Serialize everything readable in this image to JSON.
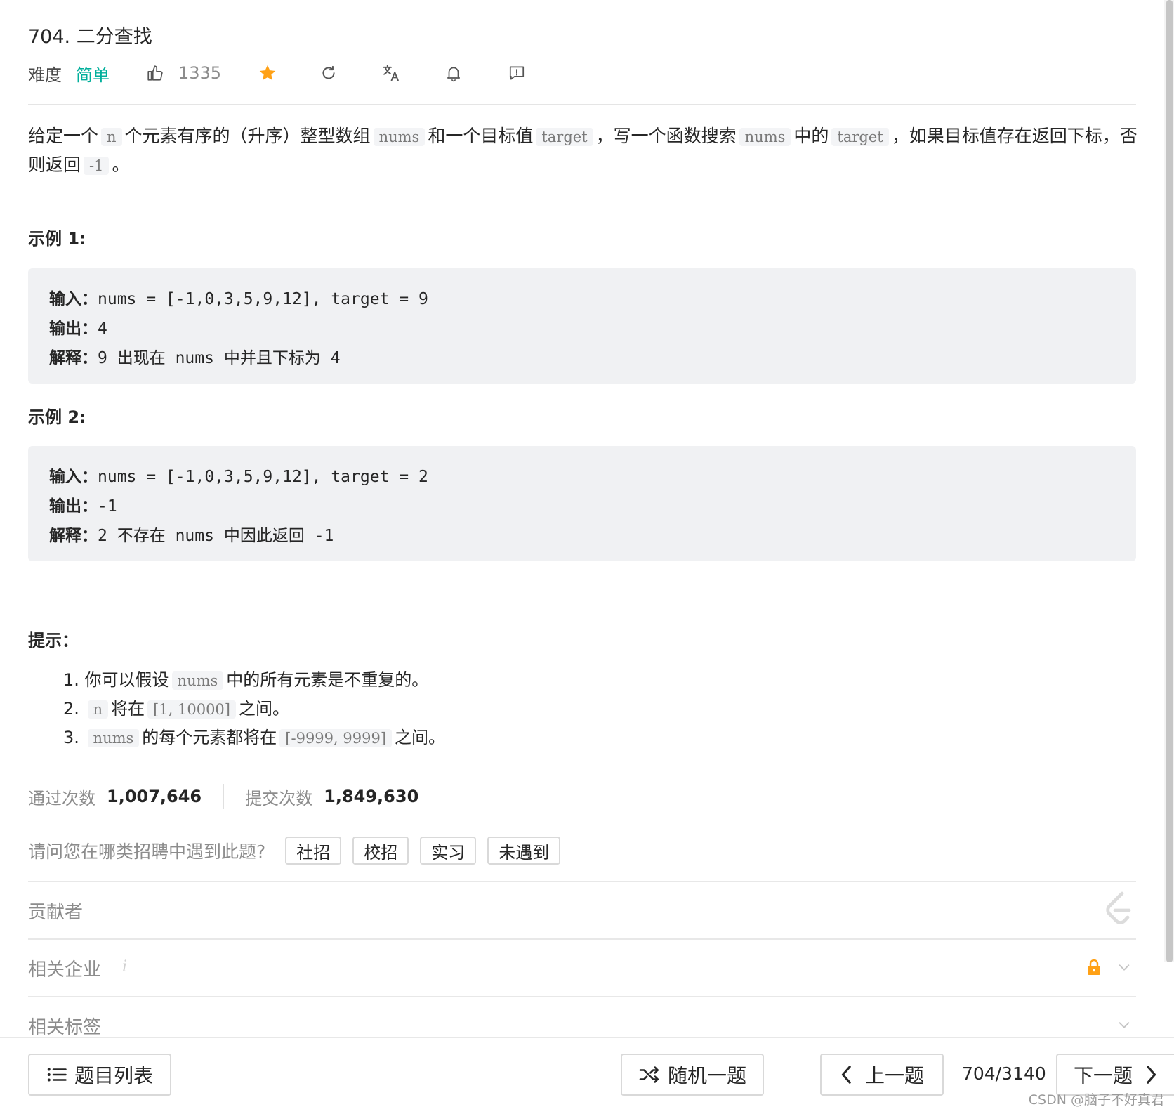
{
  "problem": {
    "title": "704. 二分查找",
    "difficulty_label": "难度",
    "difficulty": "简单",
    "likes": "1335"
  },
  "colors": {
    "easy": "#00af9b",
    "star": "#ffa116",
    "lock": "#ffa116"
  },
  "description": {
    "p1": "给定一个",
    "c1": "n",
    "p2": "个元素有序的（升序）整型数组",
    "c2": "nums",
    "p3": "和一个目标值",
    "c3": "target",
    "p4": "，写一个函数搜索",
    "c4": "nums",
    "p5": "中的",
    "c5": "target",
    "p6": "，如果目标值存在返回下标，否则返回",
    "c6": "-1",
    "p7": "。"
  },
  "examples": [
    {
      "heading": "示例 1:",
      "input_label": "输入：",
      "input": "nums = [-1,0,3,5,9,12], target = 9",
      "output_label": "输出：",
      "output": "4",
      "explain_label": "解释：",
      "explain_1": "9",
      "explain_2": "出现在",
      "explain_3": "nums",
      "explain_4": "中并且下标为",
      "explain_5": "4"
    },
    {
      "heading": "示例 2:",
      "input_label": "输入：",
      "input": "nums = [-1,0,3,5,9,12], target = 2",
      "output_label": "输出：",
      "output": "-1",
      "explain_label": "解释：",
      "explain_1": "2",
      "explain_2": "不存在",
      "explain_3": "nums",
      "explain_4": "中因此返回",
      "explain_5": "-1"
    }
  ],
  "hints": {
    "heading": "提示：",
    "items": [
      {
        "num": "1.",
        "a": "你可以假设",
        "c1": "nums",
        "b": "中的所有元素是不重复的。"
      },
      {
        "num": "2.",
        "c0": "n",
        "a": "将在",
        "c1": "[1, 10000]",
        "b": "之间。"
      },
      {
        "num": "3.",
        "c0": "nums",
        "a": "的每个元素都将在",
        "c1": "[-9999, 9999]",
        "b": "之间。"
      }
    ]
  },
  "stats": {
    "accepted_label": "通过次数",
    "accepted": "1,007,646",
    "submitted_label": "提交次数",
    "submitted": "1,849,630"
  },
  "recruit": {
    "question": "请问您在哪类招聘中遇到此题?",
    "options": [
      "社招",
      "校招",
      "实习",
      "未遇到"
    ]
  },
  "sections": {
    "contributors": "贡献者",
    "companies": "相关企业",
    "tags": "相关标签"
  },
  "footer": {
    "list_button": "题目列表",
    "random_button": "随机一题",
    "prev_button": "上一题",
    "pager": "704/3140",
    "next_button": "下一题",
    "watermark": "CSDN @脑子不好真君"
  }
}
